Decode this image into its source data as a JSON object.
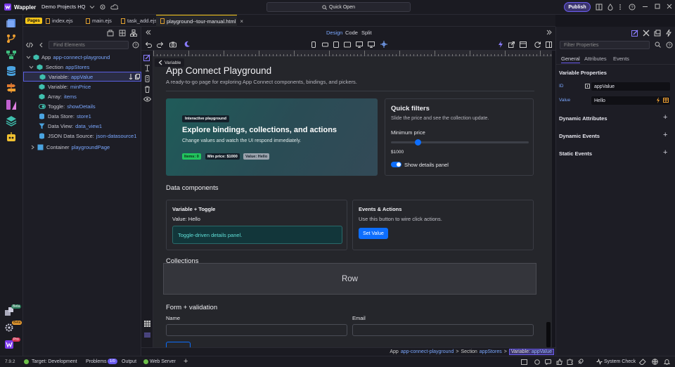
{
  "app": {
    "name": "Wappler",
    "project": "Demo Projects HQ",
    "quick_open": "Quick Open",
    "publish": "Publish"
  },
  "tabs": {
    "pages_badge": "Pages",
    "items": [
      {
        "label": "index.ejs"
      },
      {
        "label": "main.ejs"
      },
      {
        "label": "task_add.ejs"
      },
      {
        "label": "playground--tour-manual.html"
      }
    ],
    "close": "×"
  },
  "tree": {
    "find_placeholder": "Find Elements",
    "items": [
      {
        "prefix": "App",
        "name": "app-connect-playground"
      },
      {
        "prefix": "Section",
        "name": "appStores"
      },
      {
        "prefix": "Variable:",
        "name": "appValue"
      },
      {
        "prefix": "Variable:",
        "name": "minPrice"
      },
      {
        "prefix": "Array:",
        "name": "items"
      },
      {
        "prefix": "Toggle:",
        "name": "showDetails"
      },
      {
        "prefix": "Data Store:",
        "name": "store1"
      },
      {
        "prefix": "Data View:",
        "name": "data_view1"
      },
      {
        "prefix": "JSON Data Source:",
        "name": "json-datasource1"
      },
      {
        "prefix": "Container",
        "name": "playgroundPage"
      }
    ]
  },
  "view": {
    "design": "Design",
    "code": "Code",
    "split": "Split",
    "back_label": "Variable"
  },
  "page": {
    "title": "App Connect Playground",
    "subtitle": "A ready-to-go page for exploring App Connect components, bindings, and pickers.",
    "hero": {
      "badge": "Interactive playground",
      "title": "Explore bindings, collections, and actions",
      "text": "Change values and watch the UI respond immediately.",
      "chip_items": "Items: 0",
      "chip_price": "Min price: $1000",
      "chip_value": "Value: Hello"
    },
    "filters": {
      "title": "Quick filters",
      "text": "Slide the price and see the collection update.",
      "min_label": "Minimum price",
      "min_value": "$1000",
      "slider_fraction": 0.18,
      "toggle_label": "Show details panel"
    },
    "data_components": {
      "title": "Data components",
      "var_toggle": {
        "title": "Variable + Toggle",
        "value": "Value: Hello",
        "panel": "Toggle-driven details panel."
      },
      "events": {
        "title": "Events & Actions",
        "text": "Use this button to wire click actions.",
        "button": "Set Value"
      }
    },
    "collections": {
      "title": "Collections",
      "row_label": "Row"
    },
    "form": {
      "title": "Form + validation",
      "name_label": "Name",
      "email_label": "Email"
    }
  },
  "breadcrumb": {
    "app_prefix": "App",
    "app_name": "app-connect-playground",
    "sep": ">",
    "section_prefix": "Section",
    "section_name": "appStores",
    "var_prefix": "Variable:",
    "var_name": "appValue"
  },
  "props": {
    "filter_placeholder": "Filter Properties",
    "tabs": [
      "General",
      "Attributes",
      "Events"
    ],
    "section_title": "Variable Properties",
    "id_label": "ID",
    "id_value": "appValue",
    "value_label": "Value",
    "value_value": "Hello",
    "groups": [
      "Dynamic Attributes",
      "Dynamic Events",
      "Static Events"
    ]
  },
  "status": {
    "version": "7.9.2",
    "target": "Target: Development",
    "problems": "Problems",
    "problems_count": "1/0",
    "output": "Output",
    "web_server": "Web Server",
    "system_check": "System Check"
  },
  "rail": {
    "beta1": "Beta",
    "beta2": "Beta",
    "pro": "Pro"
  },
  "colors": {
    "accent": "#6b5cf0",
    "link": "#7aa7ff",
    "primary": "#0d6efd",
    "success": "#22c55e"
  }
}
